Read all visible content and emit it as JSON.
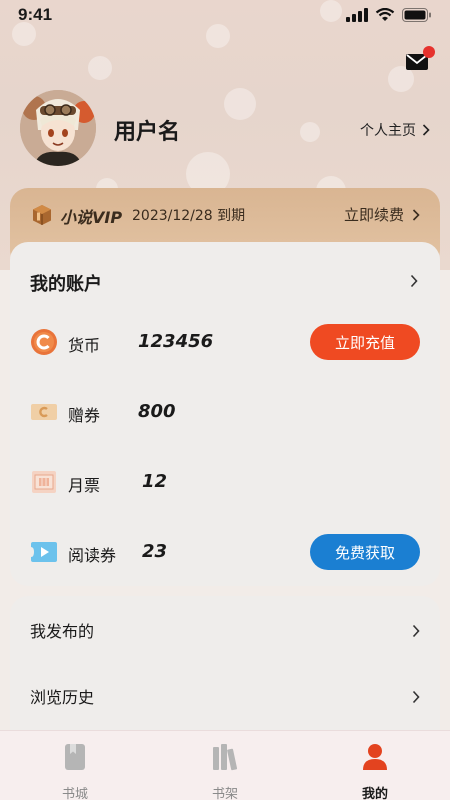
{
  "status_bar": {
    "time": "9:41"
  },
  "profile": {
    "username": "用户名",
    "homepage_label": "个人主页"
  },
  "vip": {
    "title": "小说VIP",
    "expiry": "2023/12/28 到期",
    "renew_label": "立即续费"
  },
  "account": {
    "title": "我的账户",
    "rows": [
      {
        "label": "货币",
        "value": "123456",
        "button": "立即充值",
        "icon": "coin-icon"
      },
      {
        "label": "赠券",
        "value": "800",
        "icon": "coupon-icon"
      },
      {
        "label": "月票",
        "value": "12",
        "icon": "ticket-icon"
      },
      {
        "label": "阅读券",
        "value": "23",
        "button": "免费获取",
        "icon": "video-icon"
      }
    ]
  },
  "menu": {
    "items": [
      {
        "label": "我发布的"
      },
      {
        "label": "浏览历史"
      }
    ]
  },
  "tabbar": {
    "tabs": [
      {
        "label": "书城",
        "icon": "book-icon"
      },
      {
        "label": "书架",
        "icon": "bookshelf-icon"
      },
      {
        "label": "我的",
        "icon": "user-icon"
      }
    ],
    "active": "我的"
  },
  "colors": {
    "recharge_button": "#ef4a22",
    "free_button": "#1b7fd2",
    "vip_bg": "#ddbb98",
    "mail_badge": "#e6322d",
    "active_tab": "#e3431f"
  }
}
